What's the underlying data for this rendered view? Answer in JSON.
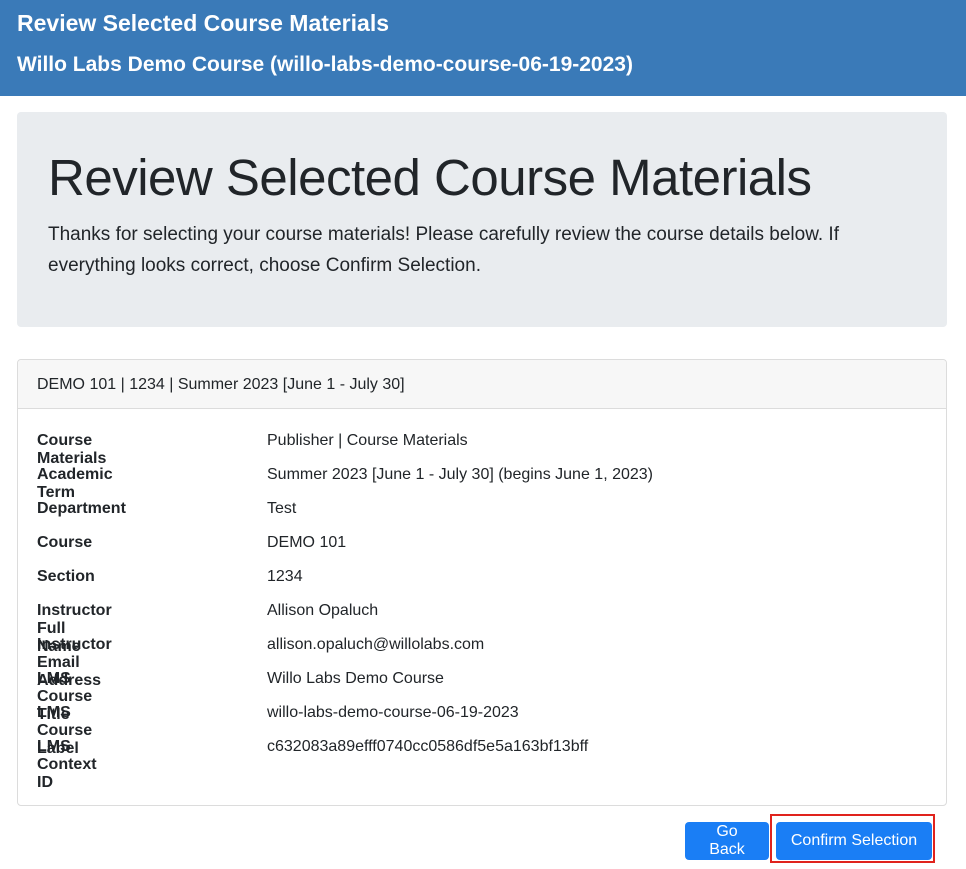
{
  "header": {
    "title": "Review Selected Course Materials",
    "subtitle": "Willo Labs Demo Course (willo-labs-demo-course-06-19-2023)"
  },
  "jumbotron": {
    "heading": "Review Selected Course Materials",
    "text": "Thanks for selecting your course materials! Please carefully review the course details below. If everything looks correct, choose Confirm Selection."
  },
  "card": {
    "header": "DEMO 101 | 1234 | Summer 2023 [June 1 - July 30]",
    "details": [
      {
        "label": "Course Materials",
        "value": "Publisher | Course Materials"
      },
      {
        "label": "Academic Term",
        "value": "Summer 2023 [June 1 - July 30] (begins June 1, 2023)"
      },
      {
        "label": "Department",
        "value": "Test"
      },
      {
        "label": "Course",
        "value": "DEMO 101"
      },
      {
        "label": "Section",
        "value": "1234"
      },
      {
        "label": "Instructor Full Name",
        "value": "Allison Opaluch"
      },
      {
        "label": "Instructor Email Address",
        "value": "allison.opaluch@willolabs.com"
      },
      {
        "label": "LMS Course Title",
        "value": "Willo Labs Demo Course"
      },
      {
        "label": "LMS Course Label",
        "value": "willo-labs-demo-course-06-19-2023"
      },
      {
        "label": "LMS Context ID",
        "value": "c632083a89efff0740cc0586df5e5a163bf13bff"
      }
    ]
  },
  "actions": {
    "go_back": "Go Back",
    "confirm": "Confirm Selection"
  },
  "colors": {
    "header_bg": "#3a7ab8",
    "button_bg": "#1a7ef5",
    "highlight": "#e0231d"
  }
}
